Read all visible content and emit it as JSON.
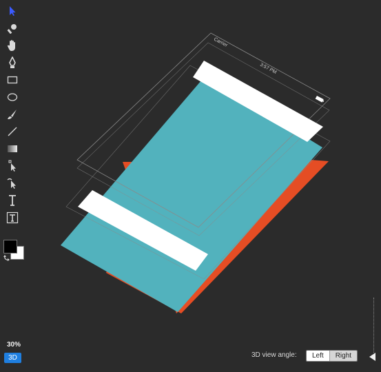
{
  "tools": [
    {
      "name": "select-arrow-icon"
    },
    {
      "name": "zoom-magnifier-icon"
    },
    {
      "name": "hand-pan-icon"
    },
    {
      "name": "pen-icon"
    },
    {
      "name": "rectangle-icon"
    },
    {
      "name": "ellipse-icon"
    },
    {
      "name": "brush-icon"
    },
    {
      "name": "line-icon"
    },
    {
      "name": "gradient-icon"
    },
    {
      "name": "direct-select-icon"
    },
    {
      "name": "anchor-select-icon"
    },
    {
      "name": "text-tool-icon"
    },
    {
      "name": "text-box-icon"
    }
  ],
  "colors": {
    "foreground": "#000000",
    "background": "#ffffff",
    "accent": "#1f7fe0"
  },
  "zoom": "30%",
  "view_mode": "3D",
  "view_angle": {
    "label": "3D view angle:",
    "options": [
      "Left",
      "Right"
    ],
    "selected": "Left"
  },
  "phone_frame": {
    "carrier": "Carrier",
    "time": "3:57 PM"
  },
  "layer_colors": {
    "teal": "#52b2bd",
    "orange": "#e54d24",
    "white": "#ffffff",
    "frame_line": "#8a8a8a"
  }
}
